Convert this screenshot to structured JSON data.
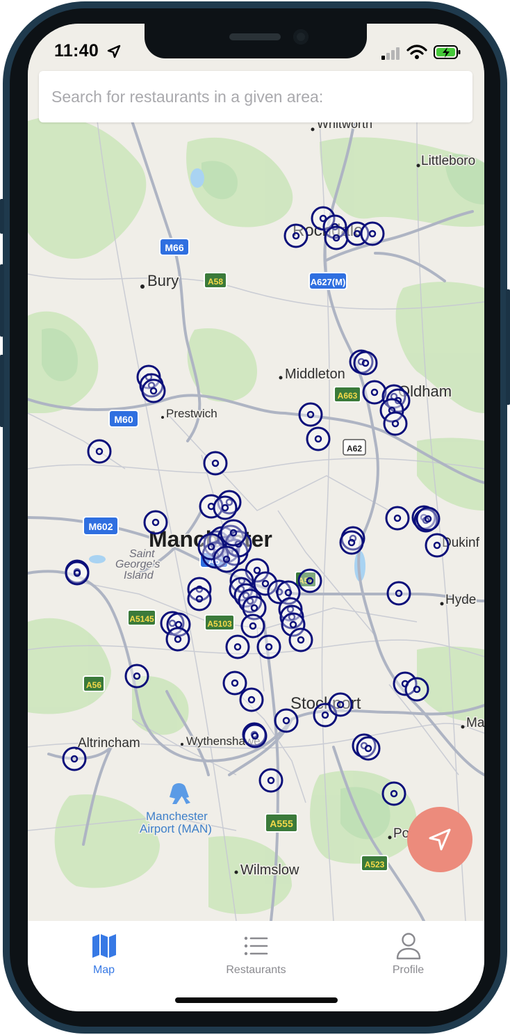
{
  "status_bar": {
    "time": "11:40"
  },
  "search": {
    "placeholder": "Search for restaurants in a given area:",
    "value": ""
  },
  "map": {
    "places": {
      "whitworth": "Whitworth",
      "littleborough": "Littleboro",
      "rochdale": "Rochdale",
      "bury": "Bury",
      "middleton": "Middleton",
      "oldham": "Oldham",
      "prestwich": "Prestwich",
      "manchester": "Manchester",
      "saint_georges_1": "Saint",
      "saint_georges_2": "George's",
      "saint_georges_3": "Island",
      "dukinfield": "Dukinf",
      "hyde": "Hyde",
      "stockport": "Stockport",
      "altrincham": "Altrincham",
      "wythenshawe": "Wythenshawe",
      "marple": "Ma",
      "airport_1": "Manchester",
      "airport_2": "Airport (MAN)",
      "poynton": "Po",
      "wilmslow": "Wilmslow"
    },
    "roads": {
      "m66": "M66",
      "a58": "A58",
      "a627m": "A627(M)",
      "a663": "A663",
      "m60": "M60",
      "a62": "A62",
      "m602": "M602",
      "a5145": "A5145",
      "a5103": "A5103",
      "a57": "A57",
      "a56": "A56",
      "a555": "A555",
      "a523": "A523",
      "a_center": "A5"
    }
  },
  "tabs": [
    {
      "label": "Map",
      "icon": "map-icon",
      "active": true
    },
    {
      "label": "Restaurants",
      "icon": "list-icon",
      "active": false
    },
    {
      "label": "Profile",
      "icon": "person-icon",
      "active": false
    }
  ],
  "colors": {
    "marker": "#0b0f7a",
    "accent": "#3779e5",
    "fab": "#ec8b7c",
    "motorway_badge": "#2f6fe0",
    "a_road_badge": "#3b7a3a",
    "a_road_text": "#f5d94a"
  }
}
